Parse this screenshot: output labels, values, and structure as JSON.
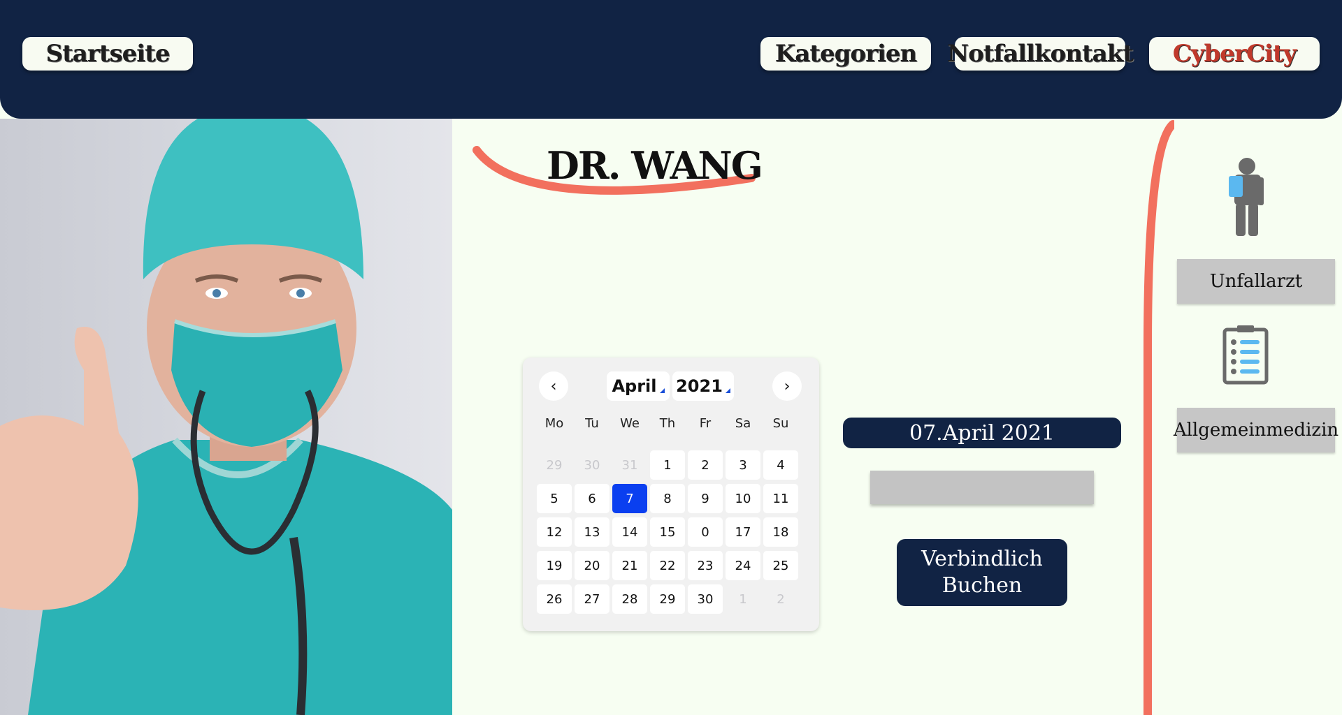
{
  "nav": {
    "home": "Startseite",
    "categories": "Kategorien",
    "emergency": "Notfallkontakt",
    "brand": "CyberCity"
  },
  "doctor": {
    "name": "DR. WANG"
  },
  "calendar": {
    "month": "April",
    "year": "2021",
    "weekdays": [
      "Mo",
      "Tu",
      "We",
      "Th",
      "Fr",
      "Sa",
      "Su"
    ],
    "rows": [
      [
        "29",
        "30",
        "31",
        "1",
        "2",
        "3",
        "4"
      ],
      [
        "5",
        "6",
        "7",
        "8",
        "9",
        "10",
        "11"
      ],
      [
        "12",
        "13",
        "14",
        "15",
        "0",
        "17",
        "18"
      ],
      [
        "19",
        "20",
        "21",
        "22",
        "23",
        "24",
        "25"
      ],
      [
        "26",
        "27",
        "28",
        "29",
        "30",
        "1",
        "2"
      ]
    ],
    "selected_day": "7"
  },
  "booking": {
    "selected_date": "07.April 2021",
    "submit_label": "Verbindlich Buchen"
  },
  "sidebar": {
    "items": [
      {
        "label": "Unfallarzt",
        "icon": "injured-person-icon"
      },
      {
        "label": "Allgemeinmedizin",
        "icon": "clipboard-list-icon"
      }
    ]
  },
  "colors": {
    "navy": "#112344",
    "accent": "#f2705e",
    "background": "#f7fef2",
    "brand_text": "#c0392b",
    "selected_day": "#0a3ff0"
  }
}
